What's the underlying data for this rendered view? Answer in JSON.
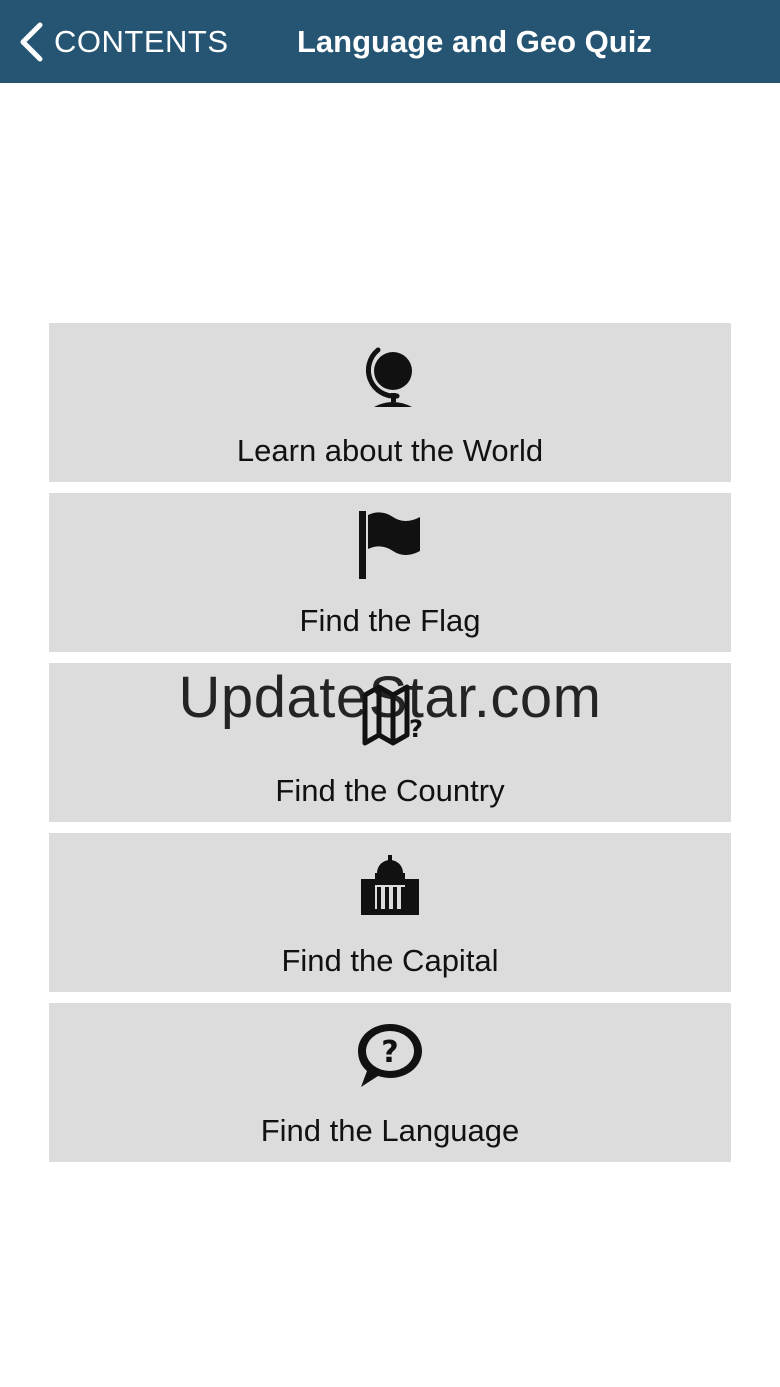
{
  "navbar": {
    "back_label": "CONTENTS",
    "back_icon": "chevron-left-icon",
    "title": "Language and Geo Quiz",
    "background_color": "#255573"
  },
  "menu": {
    "items": [
      {
        "label": "Learn about the World",
        "icon": "globe-icon"
      },
      {
        "label": "Find the Flag",
        "icon": "flag-icon"
      },
      {
        "label": "Find the Country",
        "icon": "map-question-icon"
      },
      {
        "label": "Find the Capital",
        "icon": "capitol-building-icon"
      },
      {
        "label": "Find the Language",
        "icon": "speech-bubble-question-icon"
      }
    ],
    "item_background": "#dcdcdc"
  },
  "watermark": {
    "text": "UpdateStar.com"
  }
}
